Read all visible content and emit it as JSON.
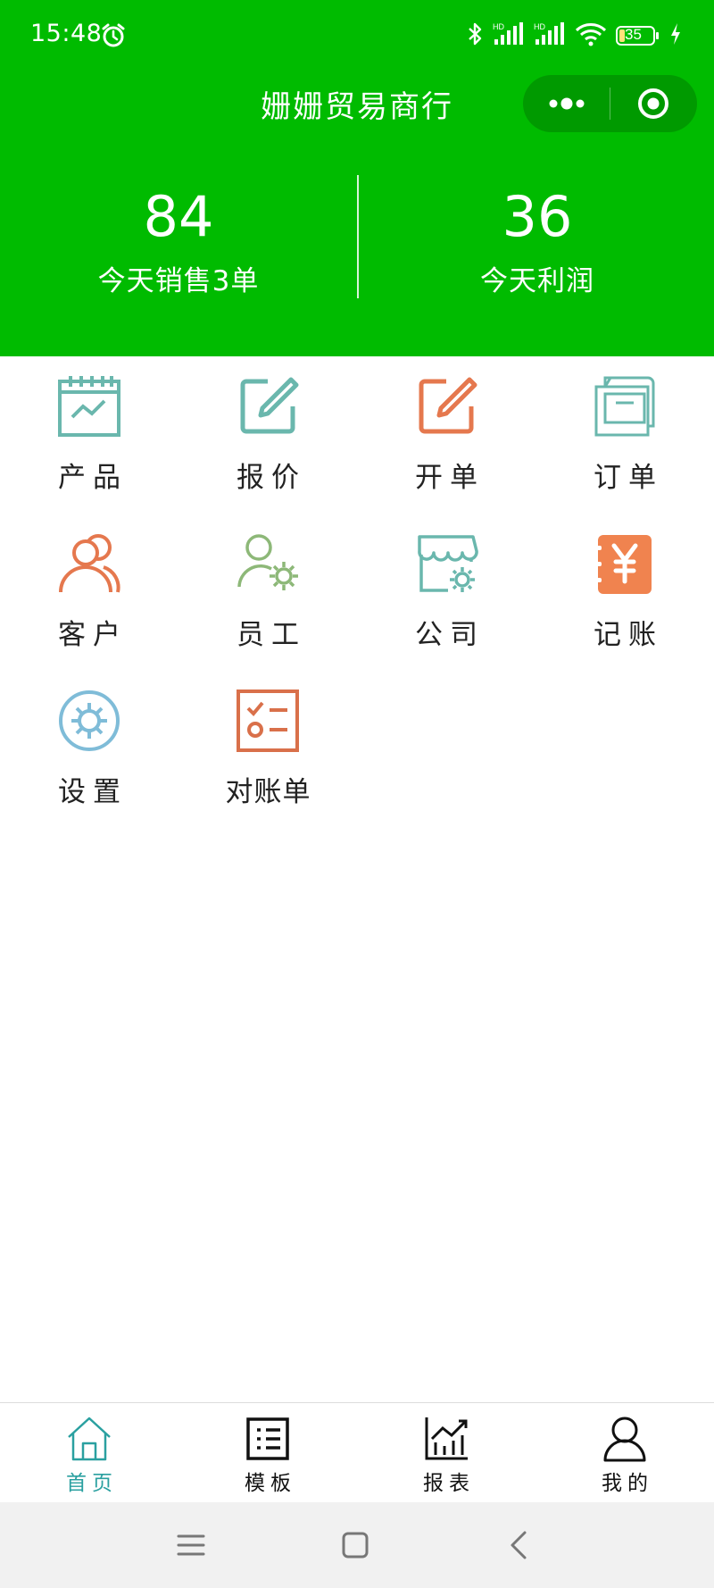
{
  "status_bar": {
    "time": "15:48",
    "battery": "35",
    "icons": [
      "alarm-icon",
      "bluetooth-icon",
      "signal-hd-icon",
      "signal-hd-icon",
      "wifi-icon",
      "battery-icon",
      "charging-icon"
    ]
  },
  "header": {
    "title": "姗姗贸易商行",
    "capsule": {
      "more_icon": "more-dots-icon",
      "close_icon": "target-icon"
    },
    "stats": [
      {
        "value": "84",
        "label": "今天销售3单"
      },
      {
        "value": "36",
        "label": "今天利润"
      }
    ]
  },
  "grid": [
    {
      "label": "产品",
      "icon": "product-chart-icon",
      "color": "#6ab7ad"
    },
    {
      "label": "报价",
      "icon": "quote-edit-icon",
      "color": "#6ab7ad"
    },
    {
      "label": "开单",
      "icon": "invoice-edit-icon",
      "color": "#e5784e"
    },
    {
      "label": "订单",
      "icon": "order-box-icon",
      "color": "#6ab7ad"
    },
    {
      "label": "客户",
      "icon": "customers-icon",
      "color": "#e5784e"
    },
    {
      "label": "员工",
      "icon": "staff-settings-icon",
      "color": "#8db878"
    },
    {
      "label": "公司",
      "icon": "company-store-icon",
      "color": "#6ab7ad"
    },
    {
      "label": "记账",
      "icon": "accounting-yen-icon",
      "color": "#f0834f"
    },
    {
      "label": "设置",
      "icon": "settings-gear-icon",
      "color": "#7fbcd8"
    },
    {
      "label": "对账单",
      "icon": "statement-checklist-icon",
      "color": "#d9704a"
    }
  ],
  "tabbar": [
    {
      "label": "首页",
      "icon": "home-icon",
      "active": true
    },
    {
      "label": "模板",
      "icon": "template-list-icon",
      "active": false
    },
    {
      "label": "报表",
      "icon": "report-chart-icon",
      "active": false
    },
    {
      "label": "我的",
      "icon": "profile-icon",
      "active": false
    }
  ],
  "colors": {
    "header_green": "#00bb00",
    "active_tab": "#2aa0a0"
  }
}
